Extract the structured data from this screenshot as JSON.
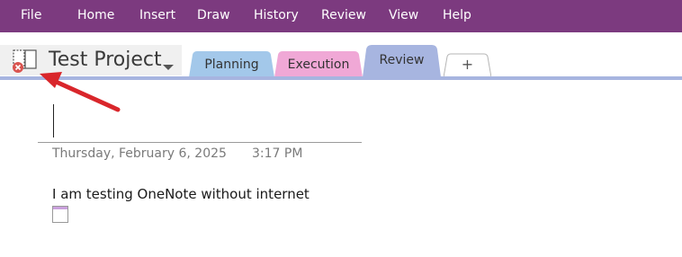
{
  "menu": {
    "items": [
      {
        "label": "File"
      },
      {
        "label": "Home"
      },
      {
        "label": "Insert"
      },
      {
        "label": "Draw"
      },
      {
        "label": "History"
      },
      {
        "label": "Review"
      },
      {
        "label": "View"
      },
      {
        "label": "Help"
      }
    ]
  },
  "notebook": {
    "title": "Test Project",
    "icon": "notebook-sync-error-icon"
  },
  "sections": {
    "tabs": [
      {
        "label": "Planning",
        "color": "#a3c8ea"
      },
      {
        "label": "Execution",
        "color": "#f0a8d6"
      },
      {
        "label": "Review",
        "color": "#a7b5e0",
        "active": true
      }
    ],
    "add_label": "+"
  },
  "page": {
    "date": "Thursday, February 6, 2025",
    "time": "3:17 PM",
    "note": "I am testing OneNote without internet"
  },
  "colors": {
    "ribbon": "#7c3a7f",
    "annotation_arrow": "#d9262b",
    "error_badge": "#d9534f"
  }
}
